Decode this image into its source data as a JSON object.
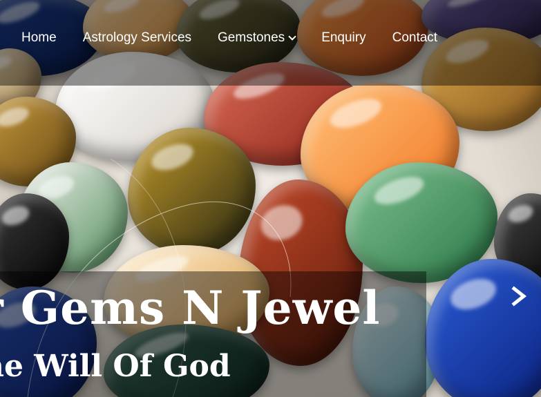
{
  "nav": {
    "items": [
      {
        "label": "Home"
      },
      {
        "label": "Astrology Services"
      },
      {
        "label": "Gemstones",
        "has_dropdown": true,
        "icon": "chevron-down-icon"
      },
      {
        "label": "Enquiry"
      },
      {
        "label": "Contact"
      }
    ]
  },
  "slide": {
    "title": "r Gems N Jewel",
    "subtitle": "he Will Of God",
    "next_icon": "chevron-right-icon"
  },
  "colors": {
    "overlay": "rgba(0,0,0,0.42)",
    "text": "#ffffff"
  }
}
